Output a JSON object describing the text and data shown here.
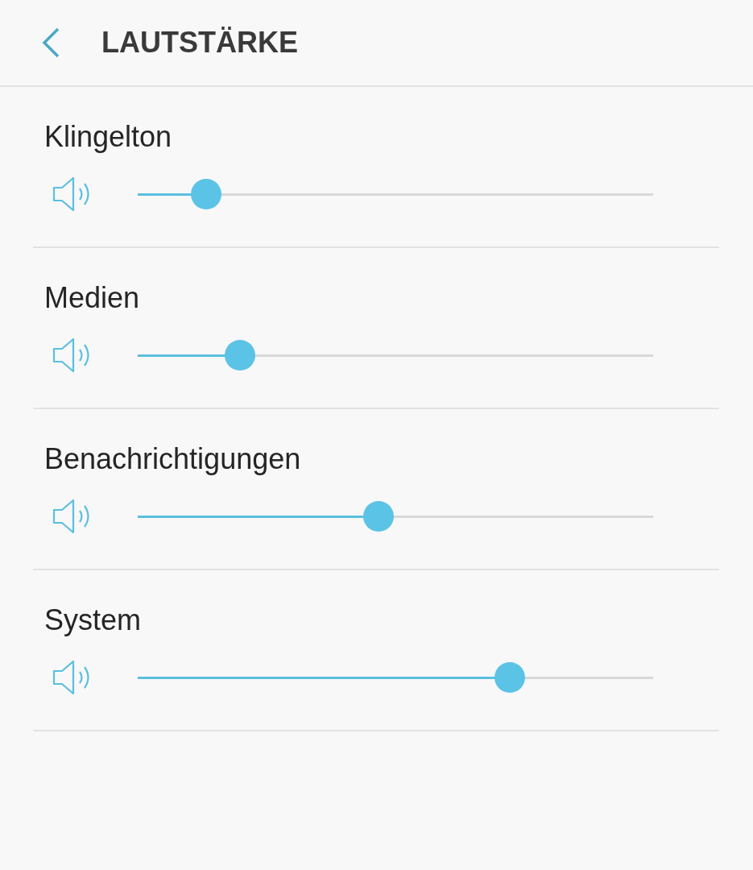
{
  "header": {
    "title": "LAUTSTÄRKE"
  },
  "channels": [
    {
      "name": "Klingelton",
      "level": 0.133
    },
    {
      "name": "Medien",
      "level": 0.198
    },
    {
      "name": "Benachrichtigungen",
      "level": 0.467
    },
    {
      "name": "System",
      "level": 0.722
    }
  ]
}
